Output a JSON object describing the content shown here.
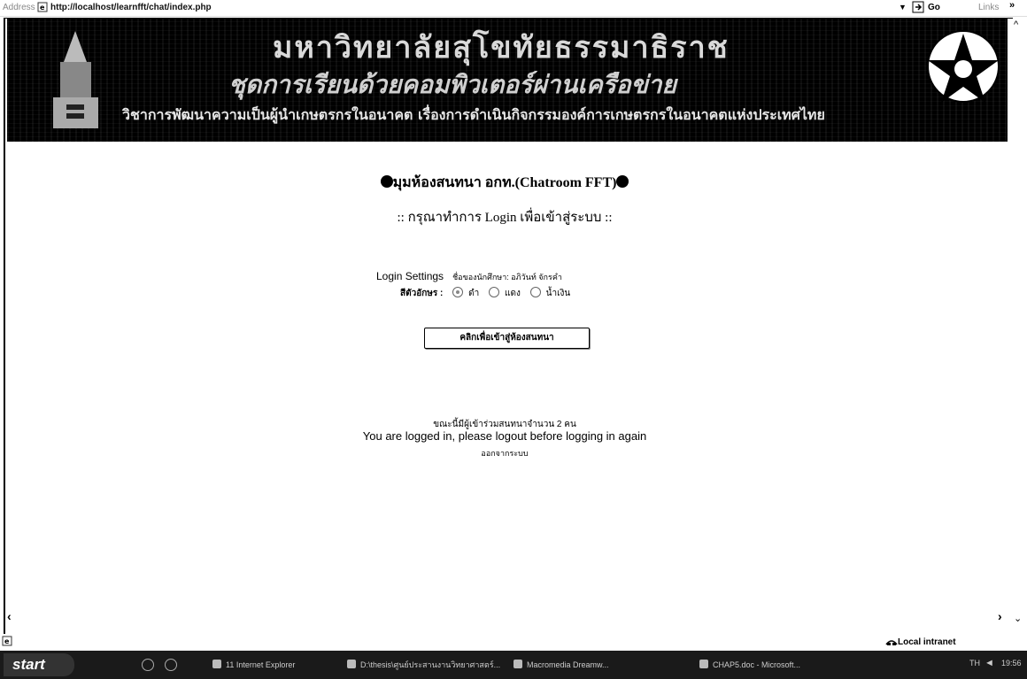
{
  "address_bar": {
    "label": "Address",
    "url": "http://localhost/learnfft/chat/index.php",
    "go_label": "Go",
    "links_label": "Links"
  },
  "banner": {
    "line1": "มหาวิทยาลัยสุโขทัยธรรมาธิราช",
    "line2": "ชุดการเรียนด้วยคอมพิวเตอร์ผ่านเครือข่าย",
    "line3": "วิชาการพัฒนาความเป็นผู้นำเกษตรกรในอนาคต เรื่องการดำเนินกิจกรรมองค์การเกษตรกรในอนาคตแห่งประเทศไทย"
  },
  "page": {
    "chat_title": "มุมห้องสนทนา อกท.(Chatroom FFT)",
    "login_prompt": ":: กรุณาทำการ Login เพื่อเข้าสู่ระบบ ::",
    "settings_label": "Login Settings",
    "student_name": "ชื่อของนักศึกษา: อภิวันท์ จักรคำ",
    "color_label": "สีตัวอักษร :",
    "color_options": [
      "ดำ",
      "แดง",
      "น้ำเงิน"
    ],
    "enter_button": "คลิกเพื่อเข้าสู่ห้องสนทนา",
    "online_count": "ขณะนี้มีผู้เข้าร่วมสนทนาจำนวน 2 คน",
    "logged_in_msg": "You are logged in, please logout before logging in again",
    "logout_link": "ออกจากระบบ"
  },
  "status_bar": {
    "zone": "Local intranet"
  },
  "taskbar": {
    "start": "start",
    "tasks": [
      "11 Internet Explorer",
      "D:\\thesis\\ศูนย์ประสานงานวิทยาศาสตร์...",
      "Macromedia Dreamw...",
      "CHAP5.doc - Microsoft..."
    ],
    "lang": "TH",
    "clock": "19:56"
  }
}
